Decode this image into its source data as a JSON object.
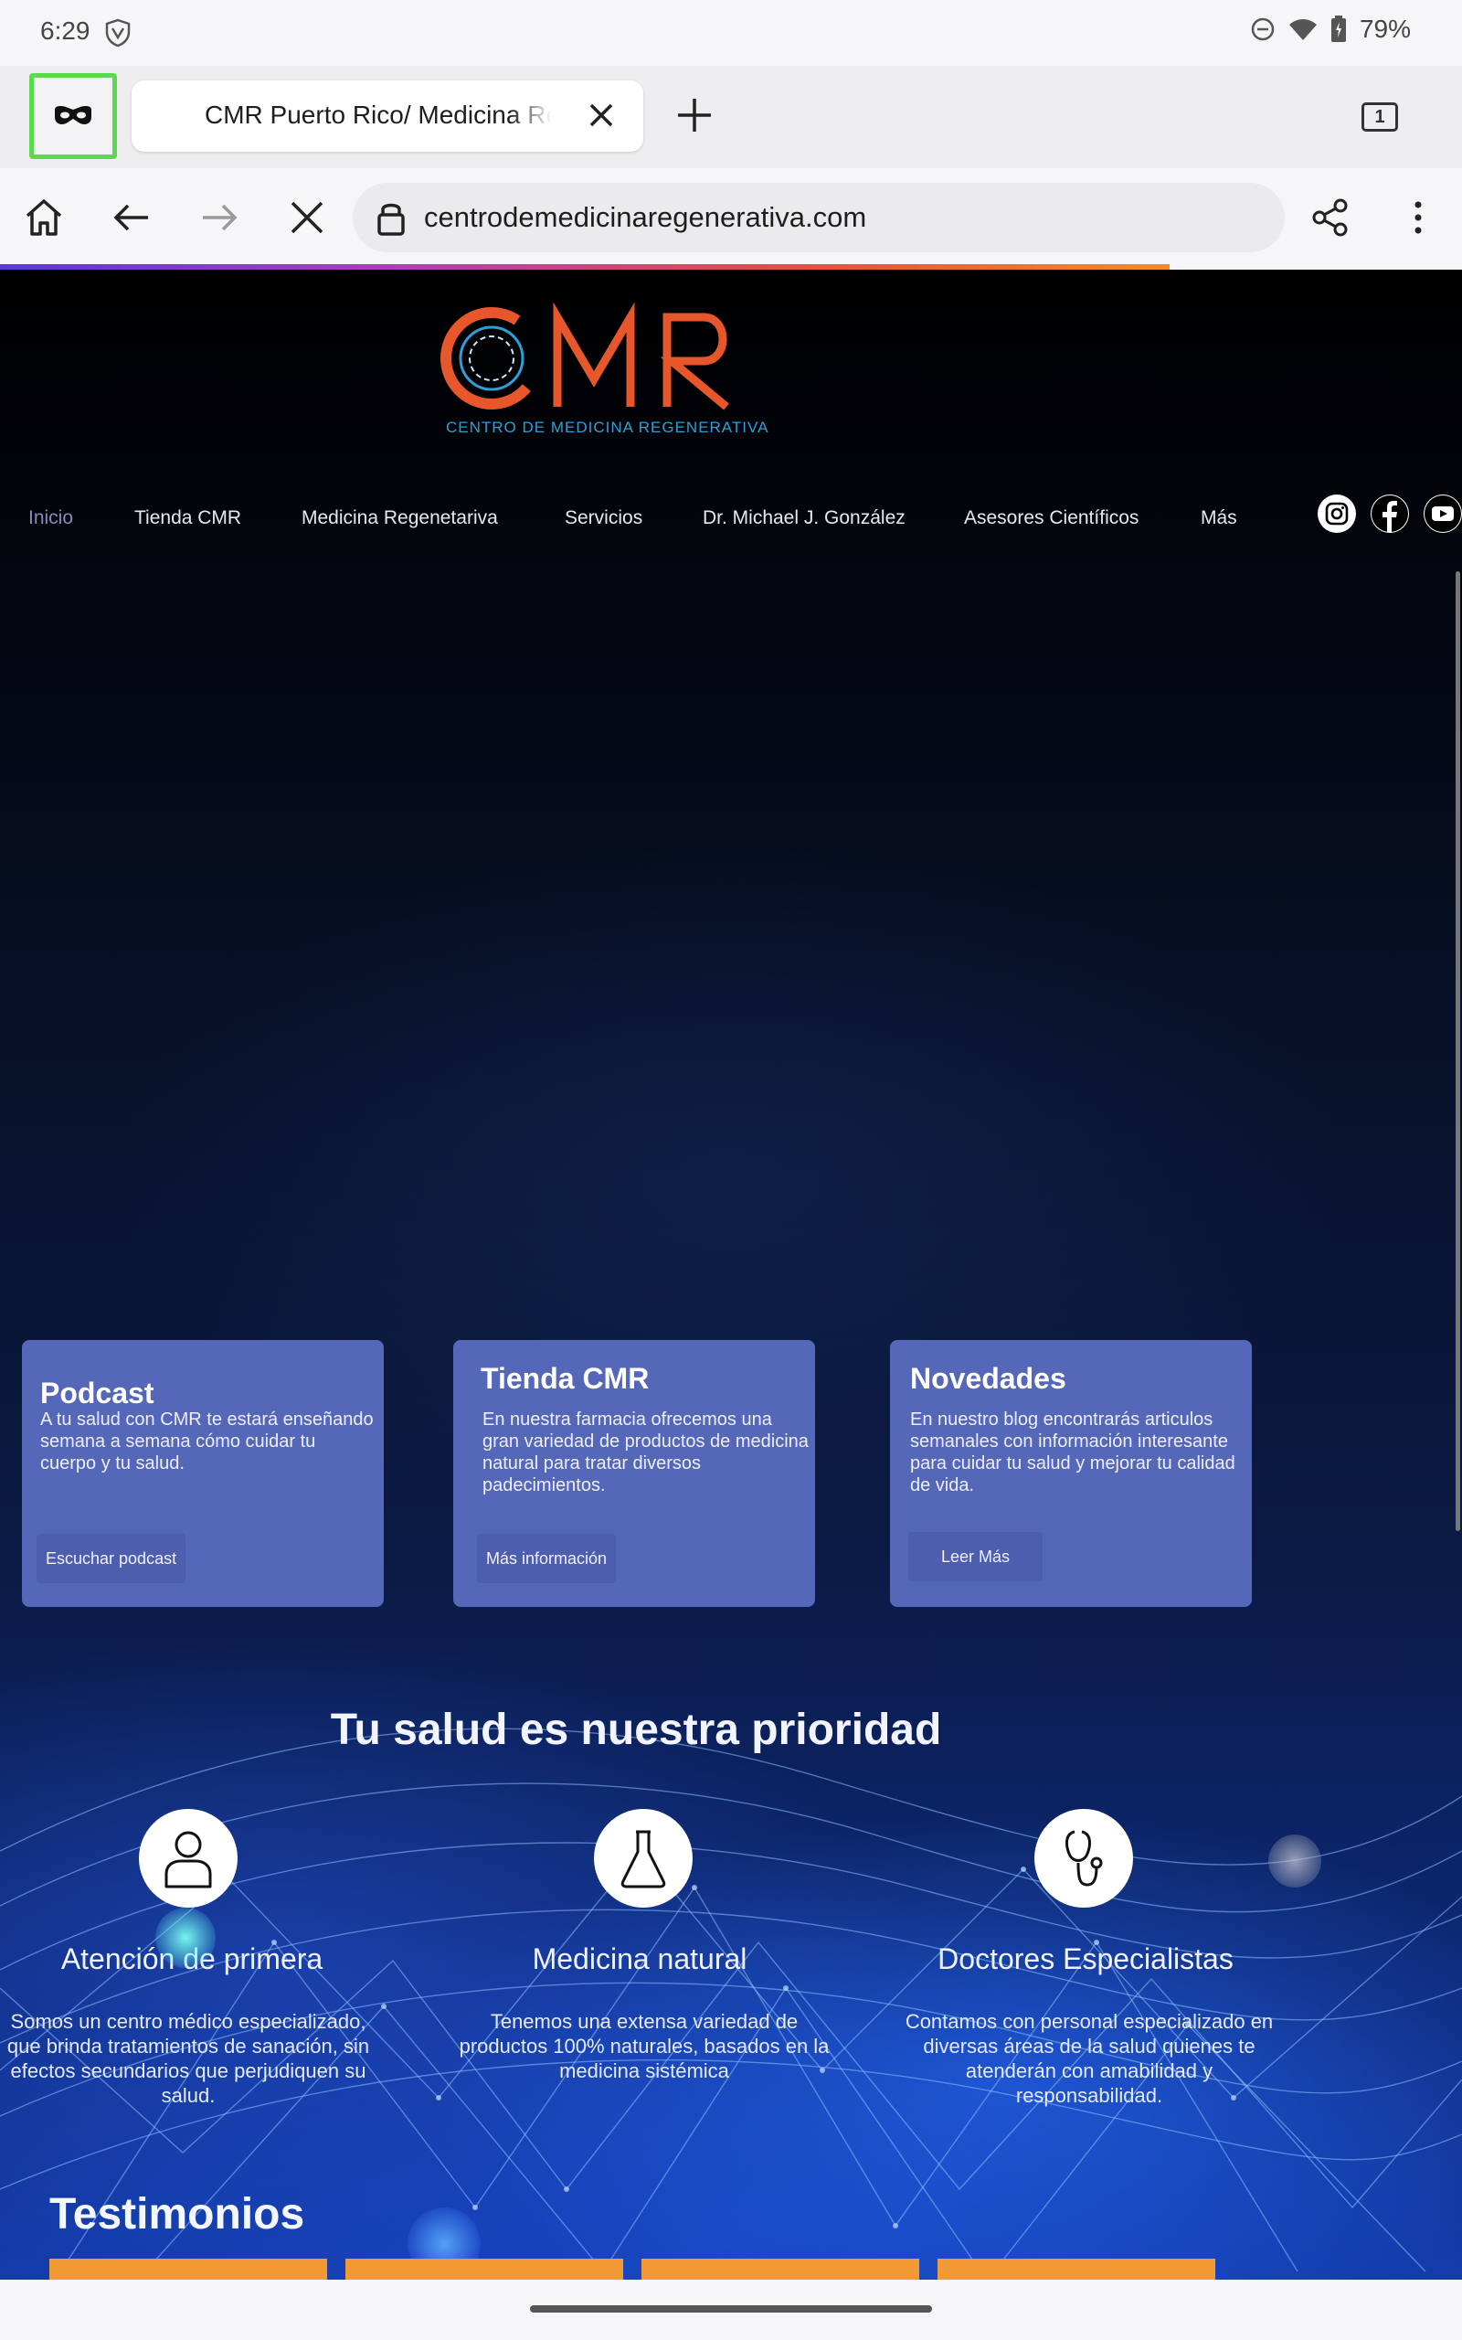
{
  "status": {
    "time": "6:29",
    "battery": "79%"
  },
  "browser": {
    "tab_title": "CMR Puerto Rico/ Medicina Regenerativa",
    "tab_count": "1",
    "url": "centrodemedicinaregenerativa.com"
  },
  "site": {
    "logo_text": "CMR",
    "logo_subtitle": "CENTRO DE MEDICINA REGENERATIVA",
    "nav": [
      "Inicio",
      "Tienda CMR",
      "Medicina Regenetariva",
      "Servicios",
      "Dr. Michael J. González",
      "Asesores Científicos",
      "Más"
    ],
    "cards": [
      {
        "title": "Podcast",
        "text": "A tu salud con CMR te estará enseñando semana a semana cómo cuidar tu cuerpo y tu salud.",
        "button": "Escuchar podcast"
      },
      {
        "title": "Tienda CMR",
        "text": "En nuestra farmacia ofrecemos una gran variedad de productos de medicina natural para tratar diversos padecimientos.",
        "button": "Más información"
      },
      {
        "title": "Novedades",
        "text": "En nuestro blog encontrarás articulos semanales con información interesante para cuidar tu salud y mejorar tu calidad de vida.",
        "button": "Leer Más"
      }
    ],
    "priority_title": "Tu salud es nuestra prioridad",
    "features": [
      {
        "title": "Atención de primera",
        "text": "Somos un centro médico especializado, que brinda tratamientos de sanación, sin efectos secundarios que perjudiquen su salud."
      },
      {
        "title": "Medicina natural",
        "text": "Tenemos una extensa variedad de productos 100% naturales, basados en la medicina sistémica"
      },
      {
        "title": "Doctores Especialistas",
        "text": "Contamos con personal especializado en diversas áreas de la salud quienes te atenderán con amabilidad y responsabilidad."
      }
    ],
    "testimonials_title": "Testimonios"
  },
  "icons": {
    "status": [
      "vpn-shield-icon",
      "do-not-disturb-icon",
      "wifi-icon",
      "battery-icon"
    ],
    "browser": [
      "incognito-mask-icon",
      "close-tab-icon",
      "new-tab-plus-icon",
      "home-icon",
      "back-arrow-icon",
      "forward-arrow-icon",
      "stop-loading-icon",
      "lock-icon",
      "share-icon",
      "more-menu-icon"
    ],
    "social": [
      "instagram-icon",
      "facebook-icon",
      "youtube-icon"
    ],
    "features": [
      "person-icon",
      "flask-icon",
      "stethoscope-icon"
    ]
  },
  "colors": {
    "brand_orange": "#e8572c",
    "brand_blue": "#2e9fd6",
    "card_bg": "#5567b8",
    "incognito_highlight": "#5bd94f",
    "testimonial_bar": "#f19a35"
  }
}
